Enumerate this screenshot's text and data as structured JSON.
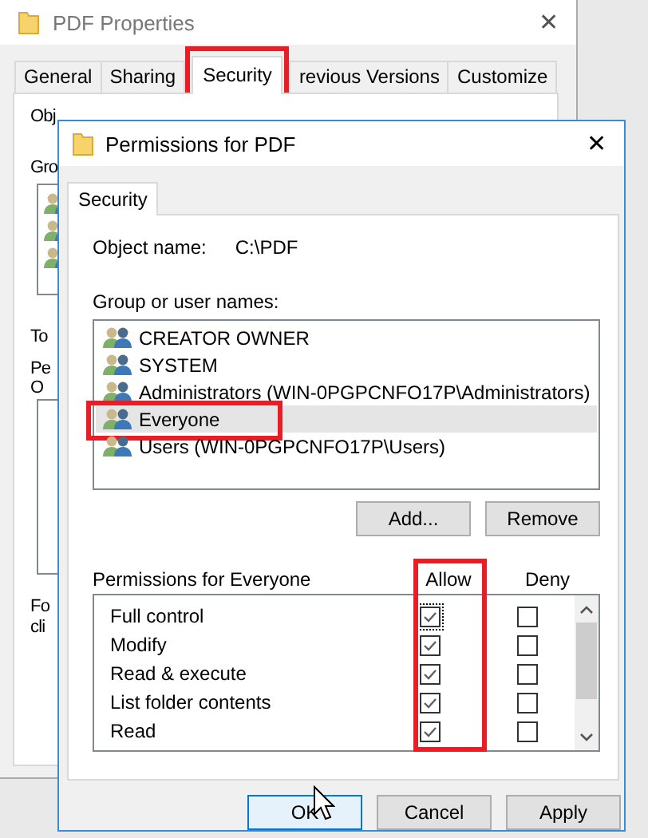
{
  "back_window": {
    "title": "PDF Properties",
    "close": "✕",
    "tabs": [
      {
        "label": "General",
        "selected": false,
        "highlighted": false
      },
      {
        "label": "Sharing",
        "selected": false,
        "highlighted": false
      },
      {
        "label": "Security",
        "selected": true,
        "highlighted": true
      },
      {
        "label": "revious Versions",
        "selected": false,
        "highlighted": false
      },
      {
        "label": "Customize",
        "selected": false,
        "highlighted": false
      }
    ],
    "obscured_labels": [
      "Obj",
      "Gro",
      "To",
      "Pe",
      "O",
      "Fo",
      "cli"
    ]
  },
  "dialog": {
    "title": "Permissions for PDF",
    "close": "✕",
    "tabs": [
      {
        "label": "Security",
        "selected": true
      }
    ],
    "object_name_label": "Object name:",
    "object_name": "C:\\PDF",
    "group_label": "Group or user names:",
    "users": [
      {
        "name": "CREATOR OWNER",
        "selected": false,
        "highlighted": false
      },
      {
        "name": "SYSTEM",
        "selected": false,
        "highlighted": false
      },
      {
        "name": "Administrators (WIN-0PGPCNFO17P\\Administrators)",
        "selected": false,
        "highlighted": false
      },
      {
        "name": "Everyone",
        "selected": true,
        "highlighted": true
      },
      {
        "name": "Users (WIN-0PGPCNFO17P\\Users)",
        "selected": false,
        "highlighted": false
      }
    ],
    "user_buttons": [
      "Add...",
      "Remove"
    ],
    "permissions_label": "Permissions for Everyone",
    "columns": [
      "Allow",
      "Deny"
    ],
    "allow_column_highlighted": true,
    "permissions": [
      {
        "name": "Full control",
        "allow": true,
        "deny": false
      },
      {
        "name": "Modify",
        "allow": true,
        "deny": false
      },
      {
        "name": "Read & execute",
        "allow": true,
        "deny": false
      },
      {
        "name": "List folder contents",
        "allow": true,
        "deny": false
      },
      {
        "name": "Read",
        "allow": true,
        "deny": false
      }
    ],
    "buttons": [
      {
        "label": "OK",
        "default": true
      },
      {
        "label": "Cancel",
        "default": false
      },
      {
        "label": "Apply",
        "default": false
      }
    ]
  }
}
